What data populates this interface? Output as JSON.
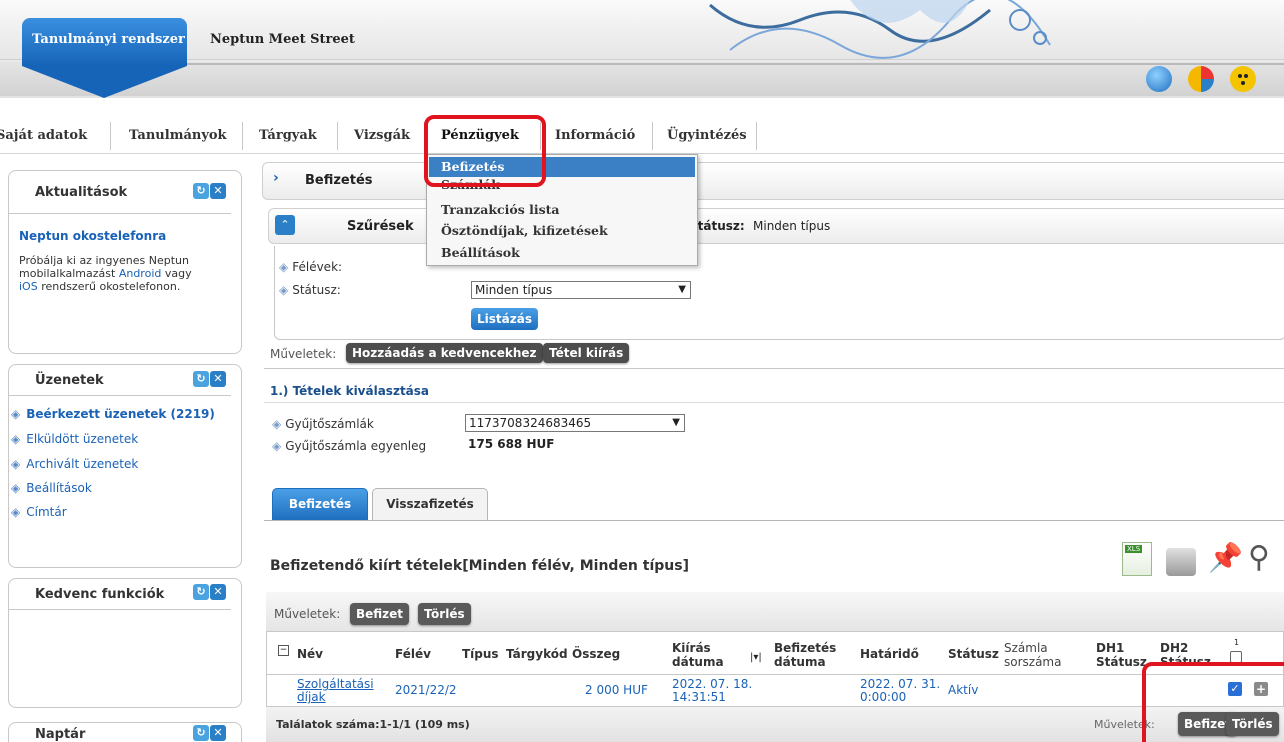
{
  "header": {
    "system_tab": "Tanulmányi rendszer",
    "meet_street": "Neptun Meet Street"
  },
  "menu": {
    "items": [
      "Saját adatok",
      "Tanulmányok",
      "Tárgyak",
      "Vizsgák",
      "Pénzügyek",
      "Információ",
      "Ügyintézés"
    ],
    "active": "Pénzügyek"
  },
  "dropdown": {
    "items": [
      "Befizetés",
      "Számlák",
      "Tranzakciós lista",
      "Ösztöndíjak, kifizetések",
      "Beállítások"
    ],
    "selected": "Befizetés"
  },
  "sidebar": {
    "aktualitasok": {
      "title": "Aktualitások",
      "news_title": "Neptun okostelefonra",
      "text_1": "Próbálja ki az ingyenes Neptun",
      "text_2a": "mobilalkalmazást",
      "text_2_link": "Android",
      "text_2b": "vagy",
      "text_3_link": "iOS",
      "text_3b": "rendszerű okostelefonon."
    },
    "uzenetek": {
      "title": "Üzenetek",
      "items": [
        "Beérkezett üzenetek (2219)",
        "Elküldött üzenetek",
        "Archivált üzenetek",
        "Beállítások",
        "Címtár"
      ]
    },
    "kedvenc": {
      "title": "Kedvenc funkciók"
    },
    "naptar": {
      "title": "Naptár"
    }
  },
  "main": {
    "page_title": "Befizetés",
    "filters": {
      "title": "Szűrések",
      "summary_label": "Státusz:",
      "summary_value": "Minden típus",
      "semesters_label": "Félévek:",
      "status_label": "Státusz:",
      "status_value": "Minden típus",
      "list_button": "Listázás"
    },
    "actions_label": "Műveletek:",
    "add_favorite": "Hozzáadás a kedvencekhez",
    "item_post": "Tétel kiírás",
    "section1_title": "1.) Tételek kiválasztása",
    "account_label": "Gyűjtőszámlák",
    "account_value": "1173708324683465",
    "balance_label": "Gyűjtőszámla egyenleg",
    "balance_value": "175 688 HUF",
    "tabs": [
      "Befizetés",
      "Visszafizetés"
    ],
    "table_title": "Befizetendő kiírt tételek[Minden félév, Minden típus]",
    "table_actions_label": "Műveletek:",
    "pay_button": "Befizet",
    "delete_button": "Törlés",
    "columns": {
      "name": "Név",
      "semester": "Félév",
      "type": "Típus",
      "subject_code": "Tárgykód",
      "amount": "Összeg",
      "posted_1": "Kiírás",
      "posted_2": "dátuma",
      "paid_1": "Befizetés",
      "paid_2": "dátuma",
      "deadline": "Határidő",
      "status": "Státusz",
      "invoice_1": "Számla",
      "invoice_2": "sorszáma",
      "dh1_1": "DH1",
      "dh1_2": "Státusz",
      "dh2_1": "DH2",
      "dh2_2": "Státusz",
      "count": "1"
    },
    "row": {
      "name_1": "Szolgáltatási",
      "name_2": "díjak",
      "semester": "2021/22/2",
      "amount": "2 000 HUF",
      "posted_1": "2022. 07. 18.",
      "posted_2": "14:31:51",
      "deadline_1": "2022. 07. 31.",
      "deadline_2": "0:00:00",
      "status": "Aktív"
    },
    "results": "Találatok száma:1-1/1 (109 ms)",
    "footer_actions_label": "Műveletek:",
    "footer_pay": "Befizet",
    "footer_delete": "Törlés"
  },
  "colors": {
    "accent_blue": "#1f6fc0",
    "highlight_red": "#e0141e",
    "link_blue": "#1a62b6"
  }
}
